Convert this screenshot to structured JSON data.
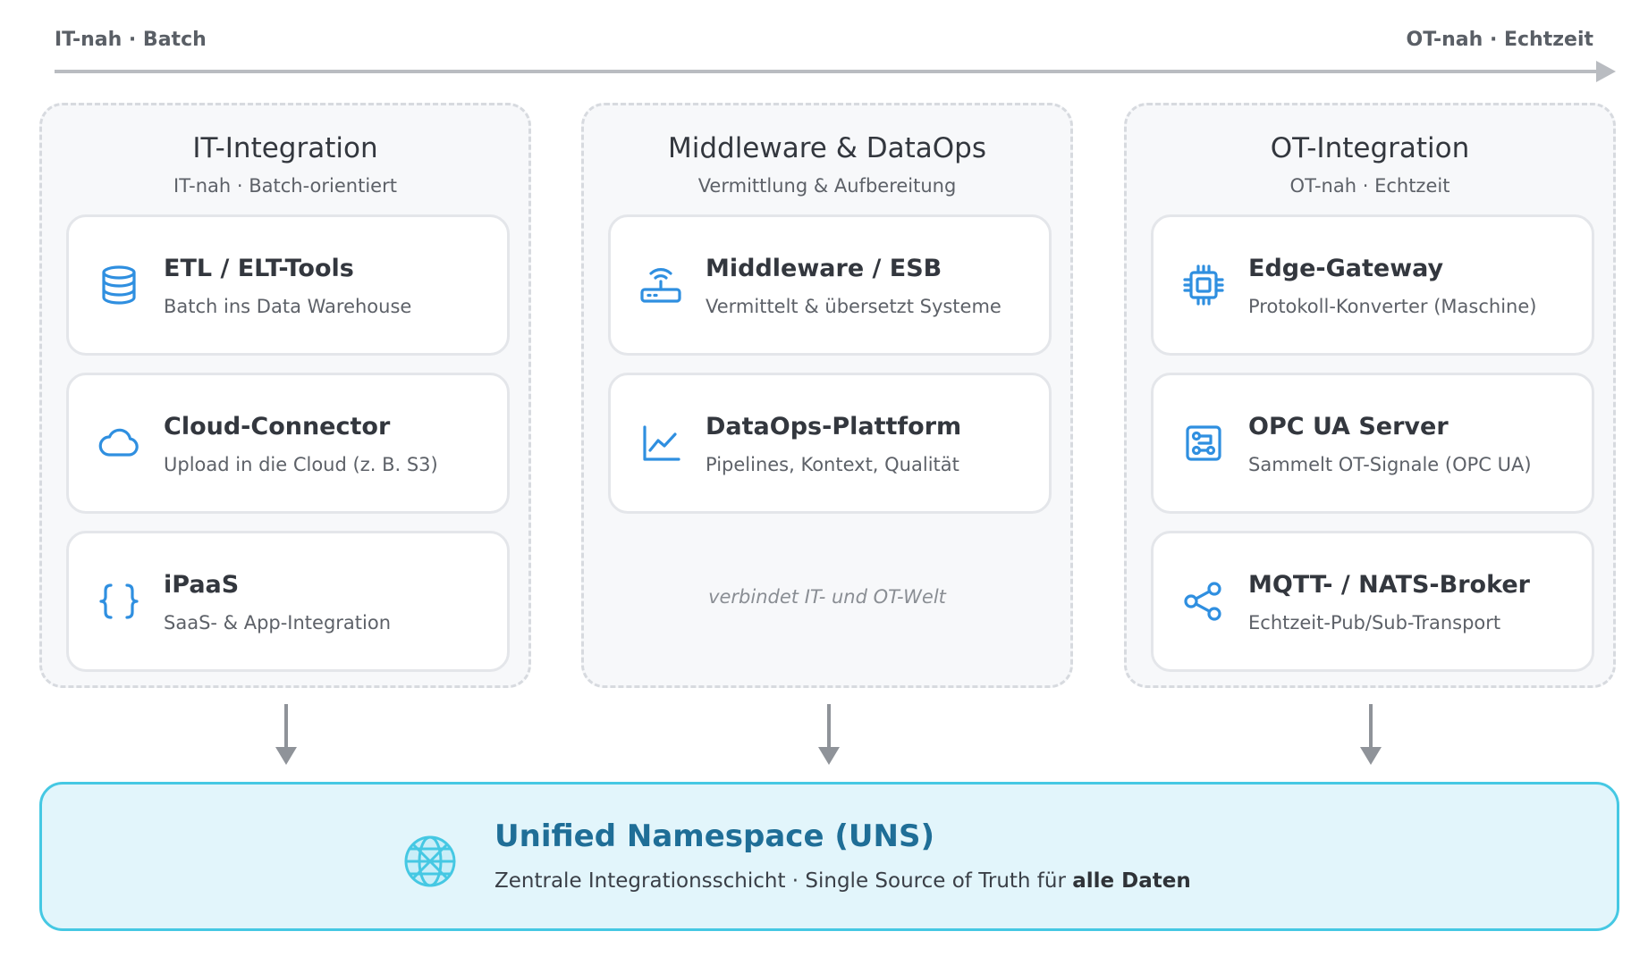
{
  "axis": {
    "left_label": "IT-nah · Batch",
    "right_label": "OT-nah · Echtzeit"
  },
  "columns": [
    {
      "title": "IT-Integration",
      "subtitle": "IT-nah · Batch-orientiert",
      "cards": [
        {
          "icon": "database-icon",
          "title": "ETL / ELT-Tools",
          "desc": "Batch ins Data Warehouse"
        },
        {
          "icon": "cloud-icon",
          "title": "Cloud-Connector",
          "desc": "Upload in die Cloud (z. B. S3)"
        },
        {
          "icon": "braces-icon",
          "title": "iPaaS",
          "desc": "SaaS- & App-Integration"
        }
      ]
    },
    {
      "title": "Middleware & DataOps",
      "subtitle": "Vermittlung & Aufbereitung",
      "cards": [
        {
          "icon": "router-icon",
          "title": "Middleware / ESB",
          "desc": "Vermittelt & übersetzt Systeme"
        },
        {
          "icon": "line-chart-icon",
          "title": "DataOps-Plattform",
          "desc": "Pipelines, Kontext, Qualität"
        }
      ],
      "note": "verbindet IT- und OT-Welt"
    },
    {
      "title": "OT-Integration",
      "subtitle": "OT-nah · Echtzeit",
      "cards": [
        {
          "icon": "chip-icon",
          "title": "Edge-Gateway",
          "desc": "Protokoll-Konverter (Maschine)"
        },
        {
          "icon": "circuit-icon",
          "title": "OPC UA Server",
          "desc": "Sammelt OT-Signale (OPC UA)"
        },
        {
          "icon": "share-icon",
          "title": "MQTT- / NATS-Broker",
          "desc": "Echtzeit-Pub/Sub-Transport"
        }
      ]
    }
  ],
  "uns": {
    "icon": "globe-network-icon",
    "title": "Unified Namespace (UNS)",
    "subtitle_prefix": "Zentrale Integrationsschicht · Single Source of Truth für ",
    "subtitle_bold": "alle Daten"
  },
  "colors": {
    "icon_blue": "#2f8fe0",
    "uns_border": "#45c8e3",
    "uns_bg": "#e2f5fb",
    "uns_title": "#1f6e97",
    "arrow_gray": "#8f9399"
  }
}
